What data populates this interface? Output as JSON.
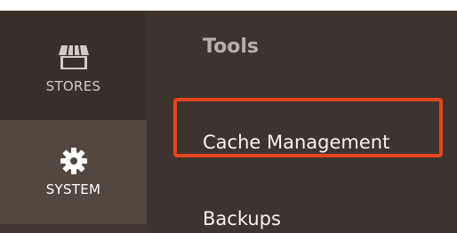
{
  "sidebar": {
    "items": [
      {
        "label": "STORES",
        "icon": "store-icon",
        "active": false
      },
      {
        "label": "SYSTEM",
        "icon": "gear-icon",
        "active": true
      }
    ]
  },
  "panel": {
    "title": "Tools",
    "items": [
      {
        "label": "Cache Management",
        "highlighted": true
      },
      {
        "label": "Backups",
        "highlighted": false
      }
    ]
  },
  "colors": {
    "highlight_border": "#e5451f",
    "sidebar_bg": "#3a302a",
    "sidebar_active_bg": "#53483f",
    "panel_bg": "#3e342e",
    "title_text": "#b9b0a8",
    "menu_text": "#f6f4f2"
  }
}
